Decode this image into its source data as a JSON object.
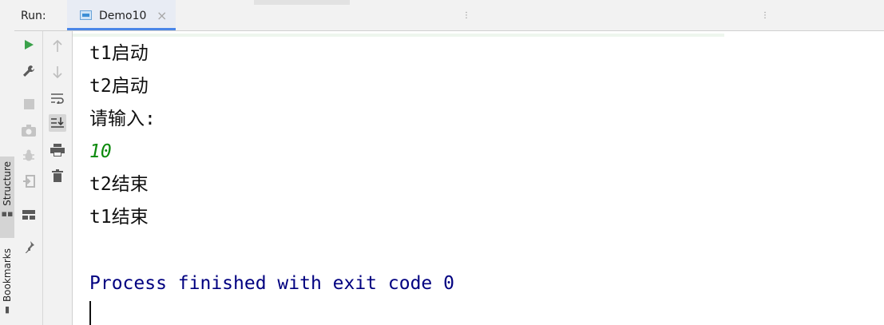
{
  "sidebar": {
    "tabs": [
      {
        "label": "Structure"
      },
      {
        "label": "Bookmarks"
      }
    ]
  },
  "header": {
    "run_label": "Run:",
    "tab": {
      "title": "Demo10",
      "close": "×"
    }
  },
  "run_toolbar": {
    "left_tools": [
      "rerun-icon",
      "wrench-icon",
      "stop-icon",
      "camera-icon",
      "debug-bug-icon",
      "exit-icon",
      "layout-icon",
      "pin-icon"
    ],
    "right_tools": [
      "up-arrow-icon",
      "down-arrow-icon",
      "soft-wrap-icon",
      "scroll-to-end-icon",
      "print-icon",
      "trash-icon"
    ]
  },
  "console": {
    "lines": [
      {
        "text": "t1启动"
      },
      {
        "text": "t2启动"
      },
      {
        "text": "请输入:"
      },
      {
        "text": "10"
      },
      {
        "text": "t2结束"
      },
      {
        "text": "t1结束"
      }
    ],
    "process_message": "Process finished with exit code 0"
  },
  "colors": {
    "accent": "#4a86e8",
    "input_text": "#0c8a0c",
    "process_text": "#000080",
    "run_green": "#3aa14a"
  }
}
